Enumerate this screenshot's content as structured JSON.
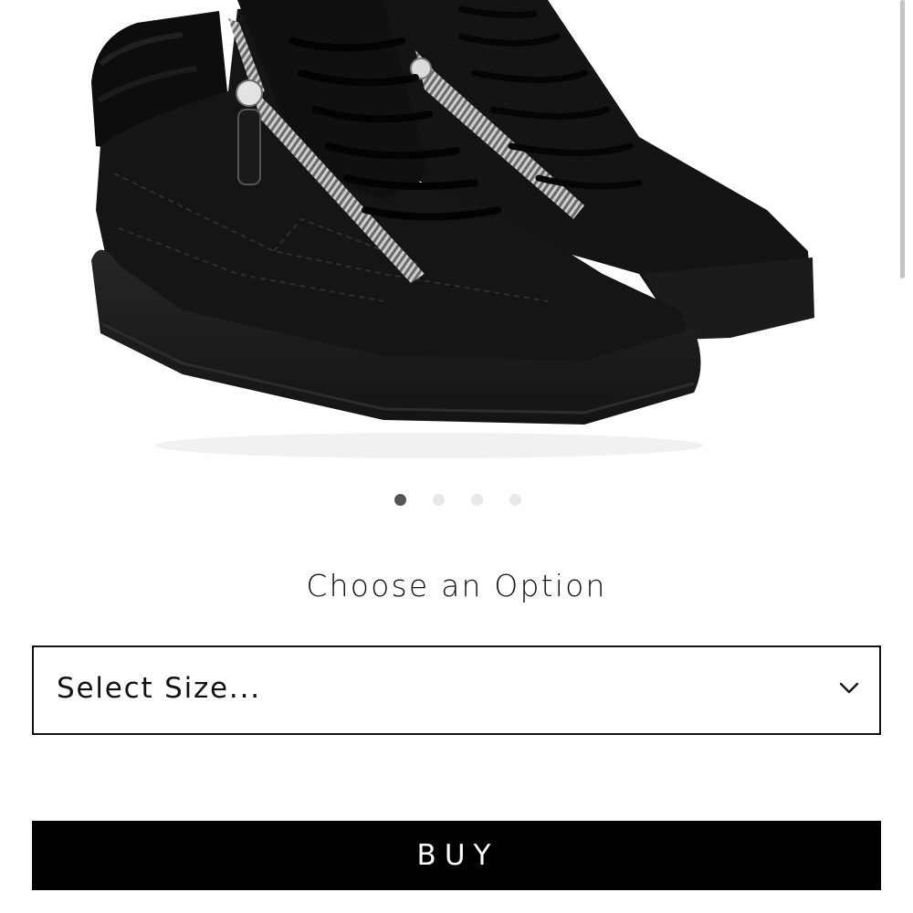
{
  "product": {
    "image_alt": "Black suede high-top sneaker with double silver zippers and shearling collar"
  },
  "carousel": {
    "total": 4,
    "active_index": 0
  },
  "options": {
    "heading": "Choose an Option",
    "size_select_label": "Select Size..."
  },
  "actions": {
    "buy_label": "BUY"
  },
  "colors": {
    "button_bg": "#000000",
    "button_text": "#ffffff",
    "dot_active": "#555555",
    "dot_inactive": "#e8e8e8"
  },
  "icons": {
    "select": "chevron-down-icon"
  }
}
